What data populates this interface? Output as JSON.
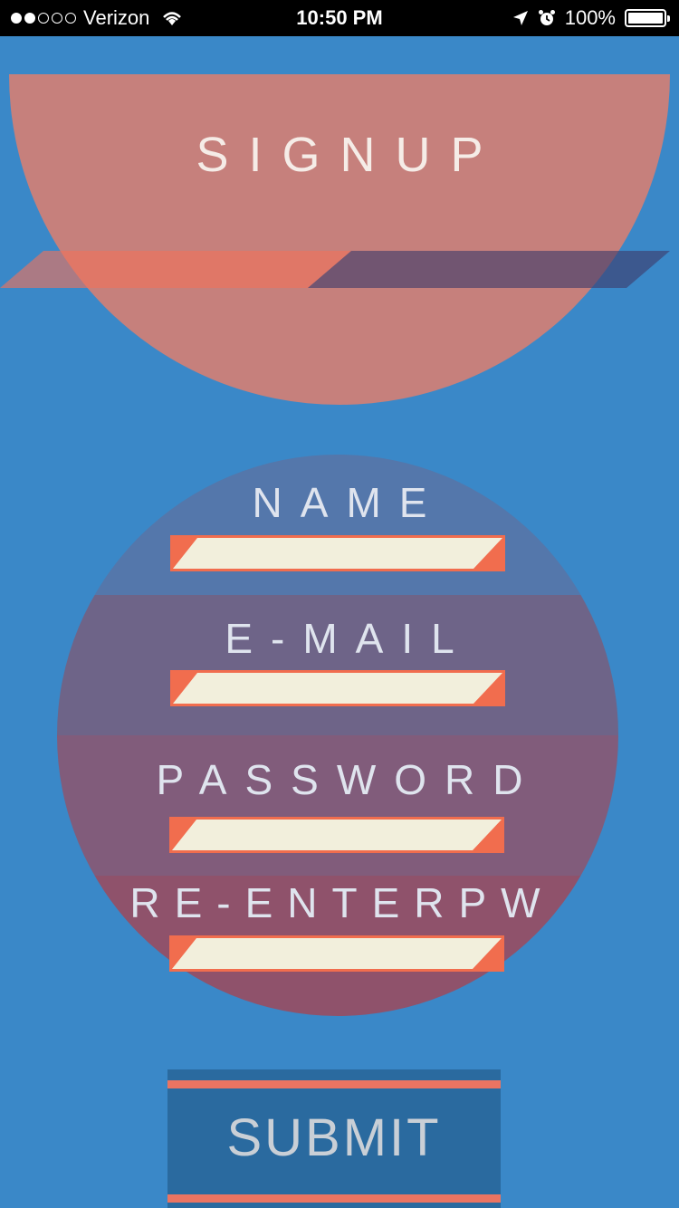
{
  "status_bar": {
    "carrier": "Verizon",
    "signal_bars_filled": 2,
    "signal_bars_total": 5,
    "time": "10:50 PM",
    "battery": "100%",
    "icons": [
      "wifi-icon",
      "location-arrow-icon",
      "alarm-icon",
      "battery-icon"
    ]
  },
  "header": {
    "title": "SIGNUP"
  },
  "form": {
    "fields": [
      {
        "label": "NAME",
        "value": ""
      },
      {
        "label": "E-MAIL",
        "value": ""
      },
      {
        "label": "PASSWORD",
        "value": ""
      },
      {
        "label": "RE-ENTERPW",
        "value": ""
      }
    ]
  },
  "submit": {
    "label": "SUBMIT"
  },
  "colors": {
    "background": "#3a88c8",
    "accent": "#f16d4e",
    "header_circle": "#c6807c",
    "input_fill": "#f2efdc",
    "submit_bg": "#2a6a9f"
  }
}
